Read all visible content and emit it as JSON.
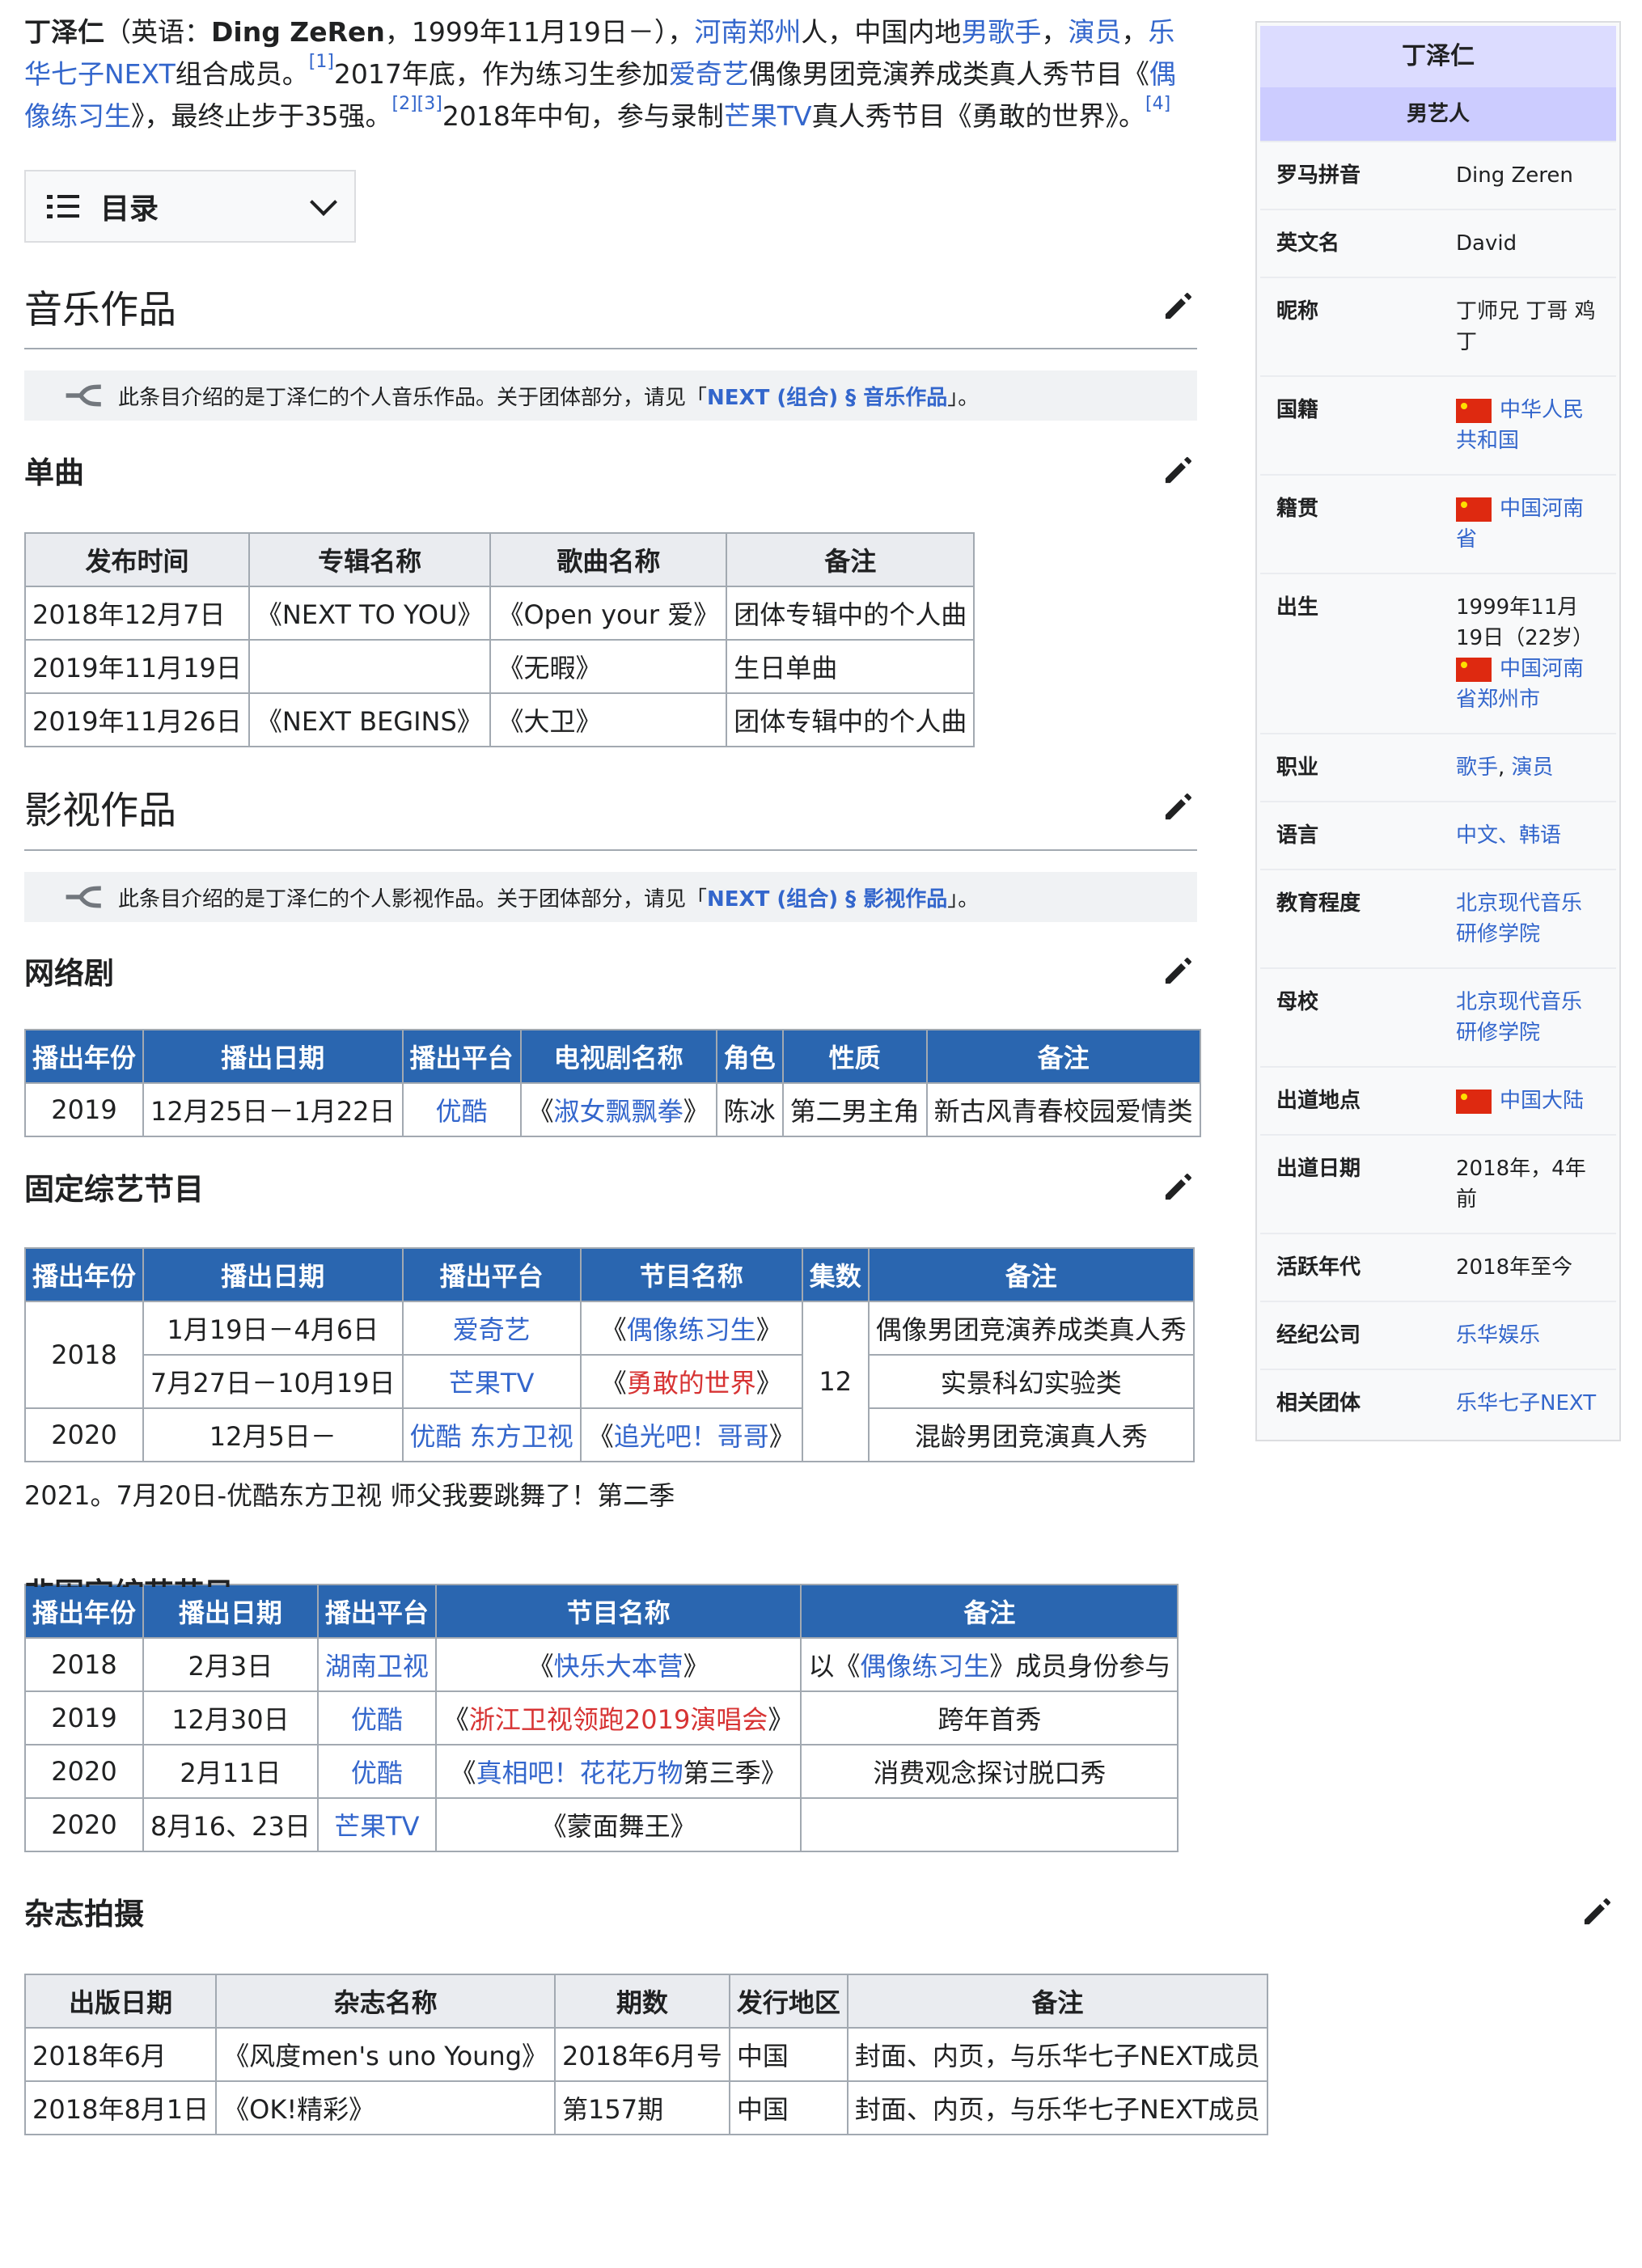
{
  "intro": {
    "name": "丁泽仁",
    "en_prefix": "（英语：",
    "en_name": "Ding ZeRen",
    "birth": "，1999年11月19日－），",
    "hometown_link": "河南郑州",
    "t1": "人，中国内地",
    "singer_link": "男歌手",
    "sep1": "，",
    "actor_link": "演员",
    "sep2": "，",
    "group_link": "乐华七子NEXT",
    "t2": "组合成员。",
    "ref1": "[1]",
    "t3": "2017年底，作为练习生参加",
    "iqiyi_link": "爱奇艺",
    "t4": "偶像男团竞演养成类真人秀节目《",
    "show_link": "偶像练习生",
    "t5": "》，最终止步于35强。",
    "ref2": "[2][3]",
    "t6": "2018年中旬，参与录制",
    "mgtv_link": "芒果TV",
    "t7": "真人秀节目《勇敢的世界》。",
    "ref4": "[4]"
  },
  "toc": {
    "label": "目录"
  },
  "music": {
    "heading": "音乐作品",
    "hatnote_text": "此条目介绍的是丁泽仁的个人音乐作品。关于团体部分，请见「",
    "hatnote_link": "NEXT (组合) § 音乐作品",
    "hatnote_end": "」。",
    "singles_heading": "单曲",
    "singles_headers": [
      "发布时间",
      "专辑名称",
      "歌曲名称",
      "备注"
    ],
    "singles_rows": [
      [
        "2018年12月7日",
        "《NEXT TO YOU》",
        "《Open your 爱》",
        "团体专辑中的个人曲"
      ],
      [
        "2019年11月19日",
        "",
        "《无暇》",
        "生日单曲"
      ],
      [
        "2019年11月26日",
        "《NEXT BEGINS》",
        "《大卫》",
        "团体专辑中的个人曲"
      ]
    ]
  },
  "film": {
    "heading": "影视作品",
    "hatnote_text": "此条目介绍的是丁泽仁的个人影视作品。关于团体部分，请见「",
    "hatnote_link": "NEXT (组合) § 影视作品",
    "hatnote_end": "」。",
    "webdrama_heading": "网络剧",
    "webdrama_headers": [
      "播出年份",
      "播出日期",
      "播出平台",
      "电视剧名称",
      "角色",
      "性质",
      "备注"
    ],
    "webdrama_row": {
      "year": "2019",
      "date": "12月25日－1月22日",
      "platform": "优酷",
      "title_open": "《",
      "title": "淑女飘飘拳",
      "title_close": "》",
      "role": "陈冰",
      "nature": "第二男主角",
      "note": "新古风青春校园爱情类"
    },
    "variety_heading": "固定综艺节目",
    "variety_headers": [
      "播出年份",
      "播出日期",
      "播出平台",
      "节目名称",
      "集数",
      "备注"
    ],
    "variety": {
      "year_2018": "2018",
      "r1_date": "1月19日－4月6日",
      "r1_platform": "爱奇艺",
      "r1_title": "偶像练习生",
      "r1_note": "偶像男团竞演养成类真人秀",
      "r2_date": "7月27日－10月19日",
      "r2_platform": "芒果TV",
      "r2_title": "勇敢的世界",
      "r2_note": "实景科幻实验类",
      "episodes": "12",
      "year_2020": "2020",
      "r3_date": "12月5日－",
      "r3_platform": "优酷 东方卫视",
      "r3_title": "追光吧！哥哥",
      "r3_note": "混龄男团竞演真人秀",
      "open": "《",
      "close": "》"
    },
    "extra_line": "2021。7月20日-优酷东方卫视 师父我要跳舞了！第二季",
    "nonfixed_heading": "非固定综艺节目",
    "nonfixed_headers": [
      "播出年份",
      "播出日期",
      "播出平台",
      "节目名称",
      "备注"
    ],
    "nonfixed": {
      "r1_year": "2018",
      "r1_date": "2月3日",
      "r1_platform": "湖南卫视",
      "r1_title": "快乐大本营",
      "r1_note_pre": "以《",
      "r1_note_link": "偶像练习生",
      "r1_note_post": "》成员身份参与",
      "r2_year": "2019",
      "r2_date": "12月30日",
      "r2_platform": "优酷",
      "r2_title": "浙江卫视领跑2019演唱会",
      "r2_note": "跨年首秀",
      "r3_year": "2020",
      "r3_date": "2月11日",
      "r3_platform": "优酷",
      "r3_title": "真相吧！花花万物",
      "r3_title_suffix": "第三季",
      "r3_note": "消费观念探讨脱口秀",
      "r4_year": "2020",
      "r4_date": "8月16、23日",
      "r4_platform": "芒果TV",
      "r4_title": "《蒙面舞王》",
      "open": "《",
      "close": "》"
    }
  },
  "magazine": {
    "heading": "杂志拍摄",
    "headers": [
      "出版日期",
      "杂志名称",
      "期数",
      "发行地区",
      "备注"
    ],
    "rows": [
      [
        "2018年6月",
        "《风度men's uno Young》",
        "2018年6月号",
        "中国",
        "封面、内页，与乐华七子NEXT成员"
      ],
      [
        "2018年8月1日",
        "《OK!精彩》",
        "第157期",
        "中国",
        "封面、内页，与乐华七子NEXT成员"
      ]
    ]
  },
  "infobox": {
    "title": "丁泽仁",
    "subtitle": "男艺人",
    "romanization_label": "罗马拼音",
    "romanization": "Ding Zeren",
    "english_label": "英文名",
    "english": "David",
    "nickname_label": "昵称",
    "nickname": "丁师兄 丁哥 鸡丁",
    "nationality_label": "国籍",
    "nationality": "中华人民共和国",
    "origin_label": "籍贯",
    "origin": "中国河南省",
    "born_label": "出生",
    "born": "1999年11月19日（22岁）",
    "born_place": "中国河南省郑州市",
    "occupation_label": "职业",
    "occupation_1": "歌手",
    "occupation_sep": ", ",
    "occupation_2": "演员",
    "language_label": "语言",
    "language": "中文、韩语",
    "education_label": "教育程度",
    "education": "北京现代音乐研修学院",
    "alma_label": "母校",
    "alma": "北京现代音乐研修学院",
    "debut_place_label": "出道地点",
    "debut_place": "中国大陆",
    "debut_date_label": "出道日期",
    "debut_date": "2018年，4年前",
    "active_label": "活跃年代",
    "active": "2018年至今",
    "agency_label": "经纪公司",
    "agency": "乐华娱乐",
    "group_label": "相关团体",
    "group": "乐华七子NEXT"
  },
  "icons": {
    "edit": "pencil-icon",
    "toc": "list-icon",
    "hatnote": "fork-icon",
    "flag": "flag-icon"
  },
  "colors": {
    "link": "#3366cc",
    "redlink": "#d73333",
    "table_header_blue": "#2a66b0",
    "infobox_header": "#ccccff"
  }
}
